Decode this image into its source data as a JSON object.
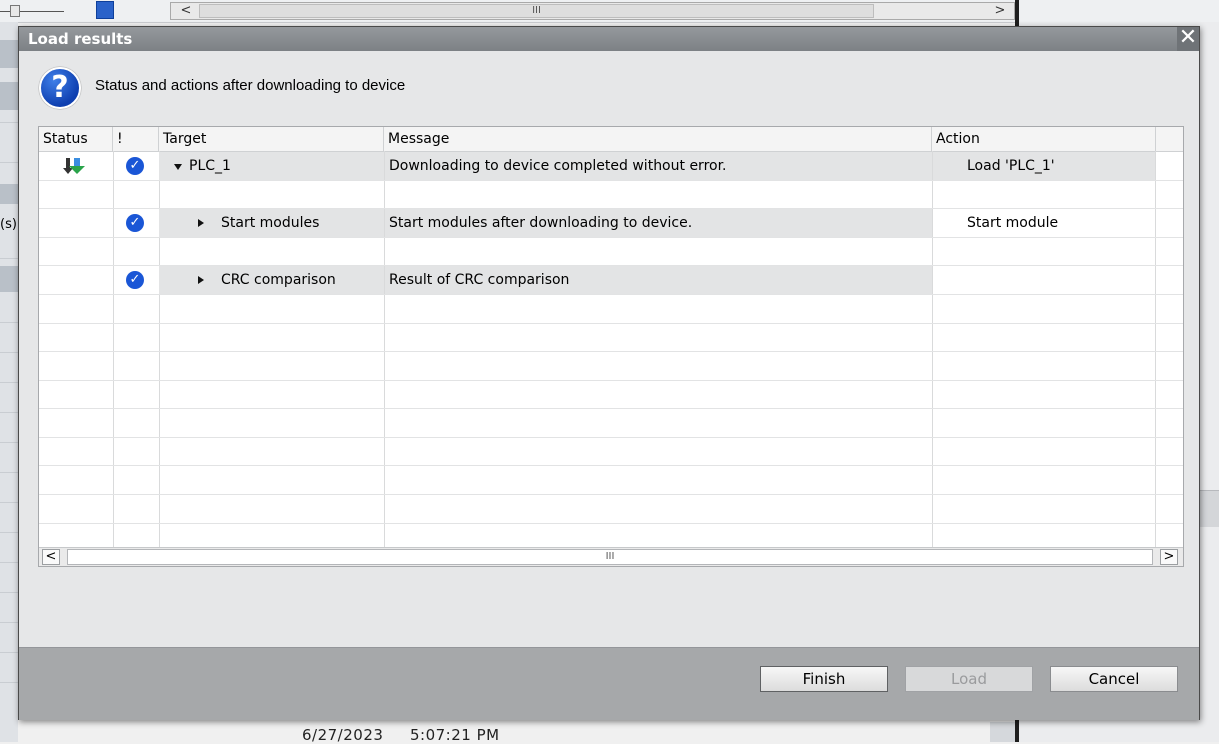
{
  "background": {
    "scroll_thumb_glyph": "III",
    "left_cut_text": "(s)",
    "date": "6/27/2023",
    "time": "5:07:21 PM",
    "scroll_left_glyph": "<",
    "scroll_right_glyph": ">"
  },
  "dialog": {
    "title": "Load results",
    "close_glyph": "✕",
    "question_glyph": "?",
    "subtitle": "Status and actions after downloading to device",
    "columns": {
      "status": "Status",
      "flag": "!",
      "target": "Target",
      "message": "Message",
      "action": "Action"
    },
    "rows": [
      {
        "target": "PLC_1",
        "message": "Downloading to device completed without error.",
        "action": "Load 'PLC_1'",
        "status_icon": "download-icon",
        "check_icon": "check-icon",
        "expanded": true
      },
      {
        "target": "Start modules",
        "message": "Start modules after downloading to device.",
        "action": "Start module",
        "check_icon": "check-icon",
        "expanded": false
      },
      {
        "target": "CRC comparison",
        "message": "Result of CRC comparison",
        "action": "",
        "check_icon": "check-icon",
        "expanded": false
      }
    ],
    "scrollbar": {
      "left": "<",
      "right": ">",
      "thumb": "III"
    },
    "buttons": {
      "finish": "Finish",
      "load": "Load",
      "cancel": "Cancel"
    },
    "colors": {
      "check": "#1a56d6",
      "title_bar": "#7d8185",
      "footer": "#a6a8aa"
    }
  }
}
